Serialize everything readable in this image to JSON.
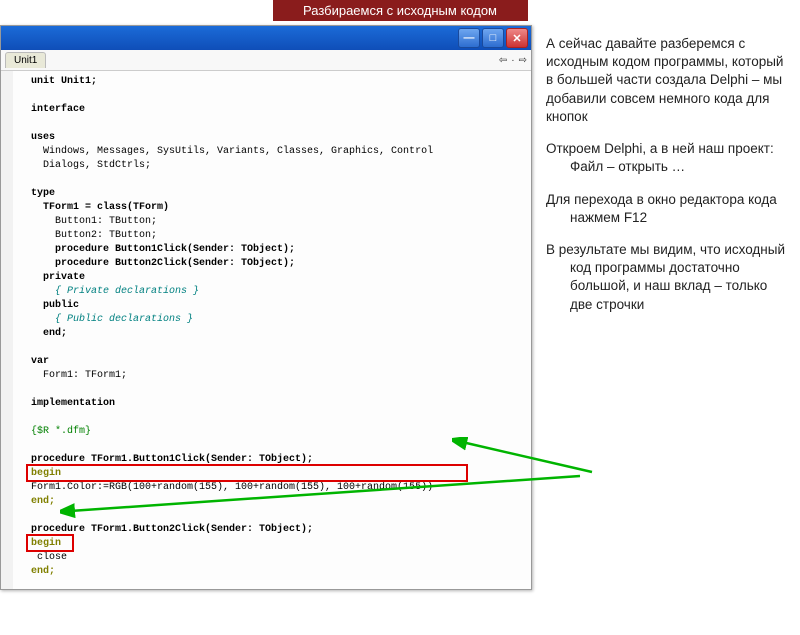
{
  "header": {
    "title": "Разбираемся с исходным кодом"
  },
  "editor": {
    "tab": "Unit1",
    "code_lines": [
      {
        "t": "unit Unit1;",
        "cls": "kw"
      },
      {
        "t": ""
      },
      {
        "t": "interface",
        "cls": "kw"
      },
      {
        "t": ""
      },
      {
        "t": "uses",
        "cls": "kw"
      },
      {
        "t": "  Windows, Messages, SysUtils, Variants, Classes, Graphics, Control"
      },
      {
        "t": "  Dialogs, StdCtrls;"
      },
      {
        "t": ""
      },
      {
        "t": "type",
        "cls": "kw"
      },
      {
        "t": "  TForm1 = class(TForm)",
        "cls": "kw"
      },
      {
        "t": "    Button1: TButton;"
      },
      {
        "t": "    Button2: TButton;"
      },
      {
        "t": "    procedure Button1Click(Sender: TObject);",
        "cls": "kw"
      },
      {
        "t": "    procedure Button2Click(Sender: TObject);",
        "cls": "kw"
      },
      {
        "t": "  private",
        "cls": "kw"
      },
      {
        "t": "    { Private declarations }",
        "cls": "cm"
      },
      {
        "t": "  public",
        "cls": "kw"
      },
      {
        "t": "    { Public declarations }",
        "cls": "cm"
      },
      {
        "t": "  end;",
        "cls": "kw"
      },
      {
        "t": ""
      },
      {
        "t": "var",
        "cls": "kw"
      },
      {
        "t": "  Form1: TForm1;"
      },
      {
        "t": ""
      },
      {
        "t": "implementation",
        "cls": "kw"
      },
      {
        "t": ""
      },
      {
        "t": "{$R *.dfm}",
        "cls": "directive"
      },
      {
        "t": ""
      },
      {
        "t": "procedure TForm1.Button1Click(Sender: TObject);",
        "cls": "kw"
      },
      {
        "t": "begin",
        "cls": "dk"
      },
      {
        "t": "Form1.Color:=RGB(100+random(155), 100+random(155), 100+random(155))"
      },
      {
        "t": "end;",
        "cls": "dk"
      },
      {
        "t": ""
      },
      {
        "t": "procedure TForm1.Button2Click(Sender: TObject);",
        "cls": "kw"
      },
      {
        "t": "begin",
        "cls": "dk"
      },
      {
        "t": " close"
      },
      {
        "t": "end;",
        "cls": "dk"
      }
    ]
  },
  "side": {
    "p1": " А сейчас давайте разберемся с исходным кодом программы, который в большей части создала Delphi – мы добавили совсем немного кода для кнопок",
    "items": [
      "Откроем  Delphi, а в ней наш проект: Файл – открыть …",
      "Для перехода в окно редактора кода нажмем F12",
      "В результате мы видим, что исходный код программы достаточно большой, и наш вклад – только две строчки"
    ]
  },
  "highlights": {
    "line1": "Form1.Color:=RGB(100+random(155), 100+random(155), 100+random(155))",
    "line2": "close"
  }
}
